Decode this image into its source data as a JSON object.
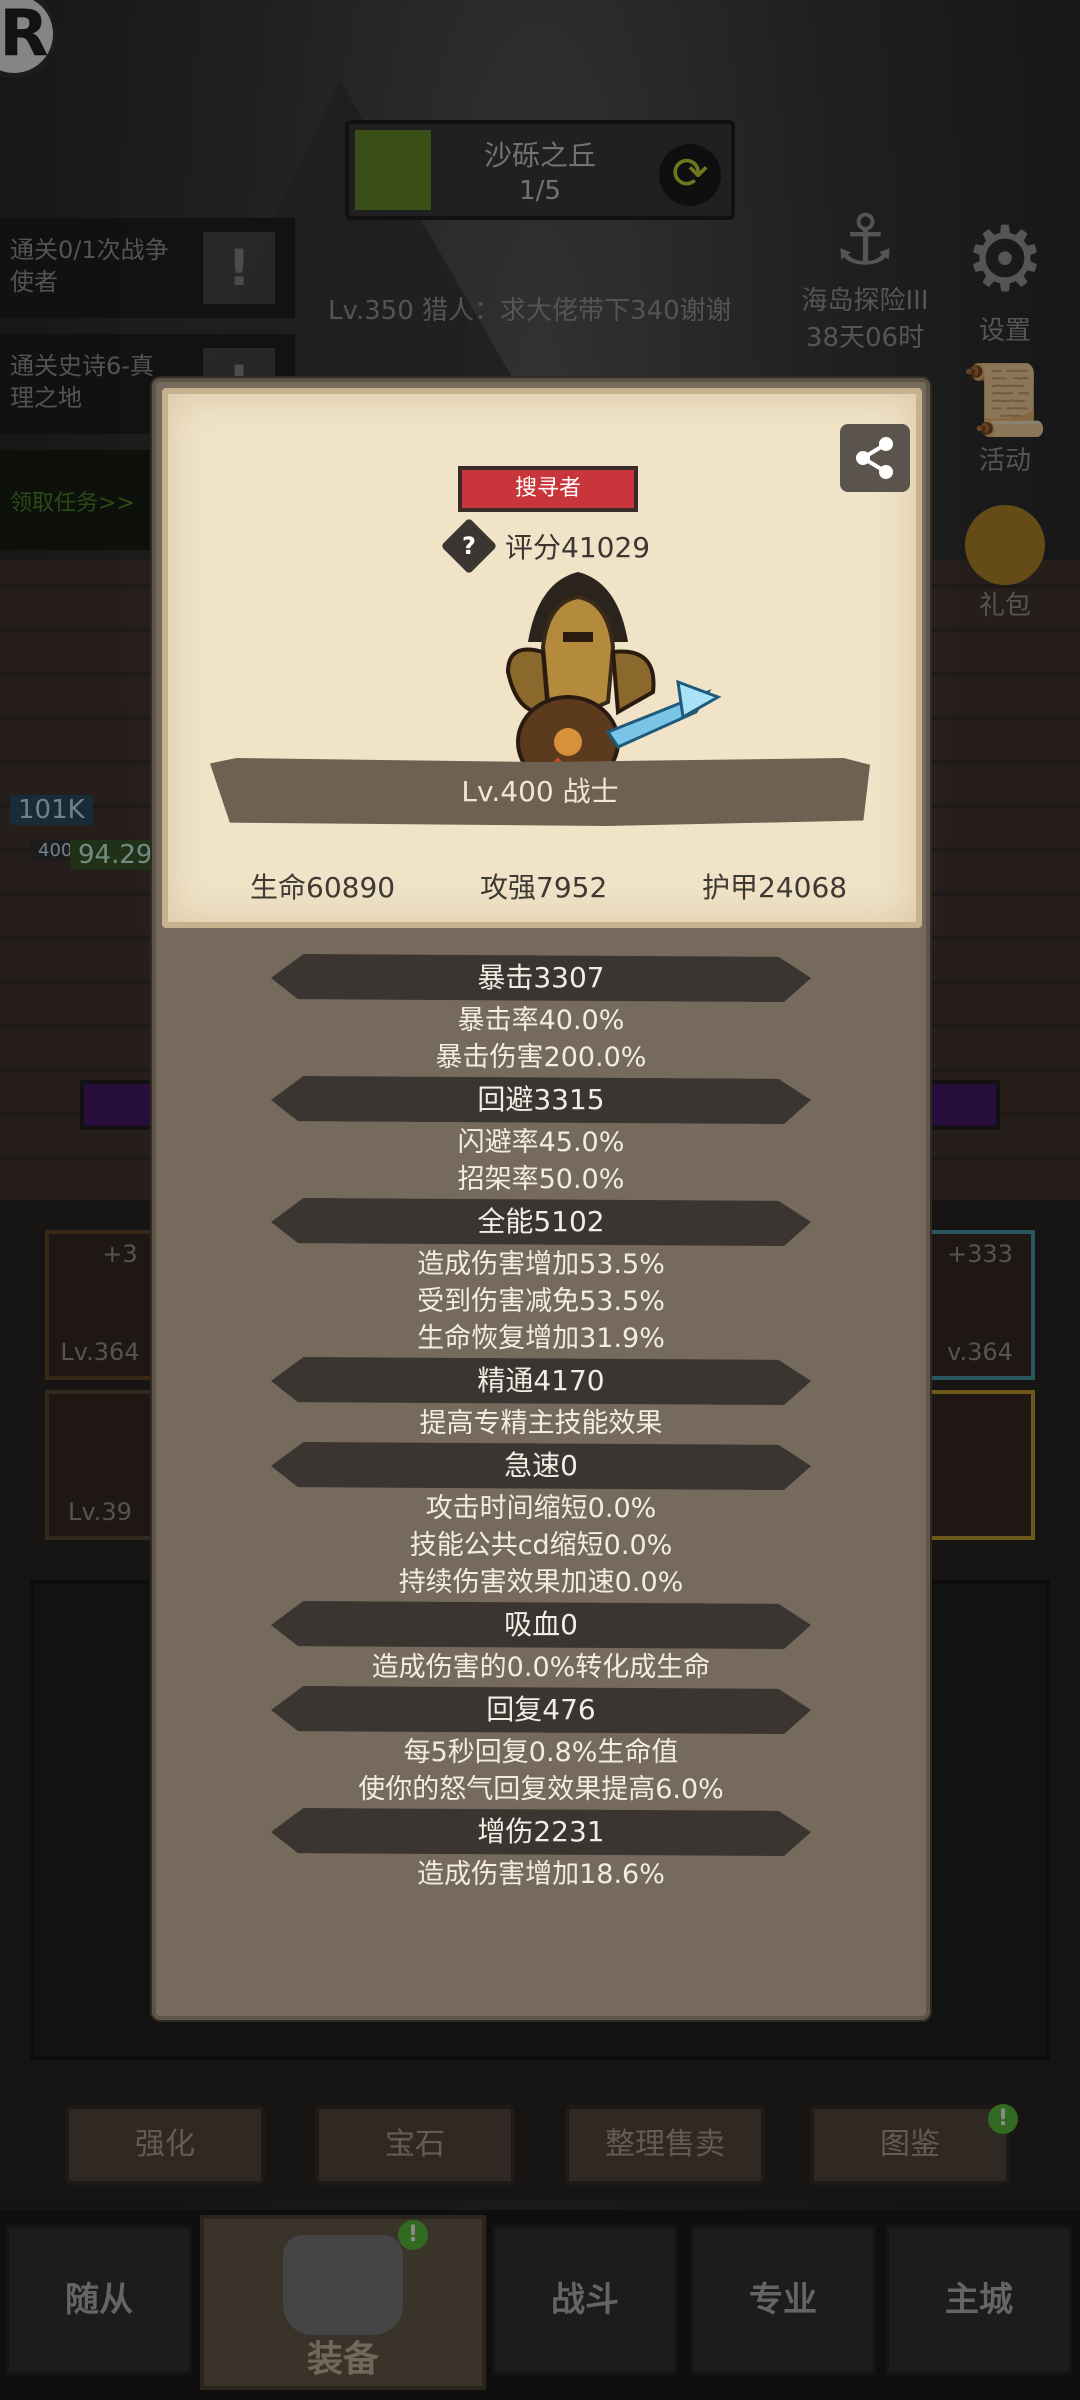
{
  "stage": {
    "name": "沙砾之丘",
    "progress": "1/5",
    "progress_fraction": 0.2
  },
  "hunter_line": "Lv.350 猎人：求大佬带下340谢谢",
  "left_tasks": [
    {
      "label": "通关0/1次战争使者"
    },
    {
      "label": "通关史诗6-真理之地"
    }
  ],
  "claim_task": "领取任务>>",
  "right_menu": {
    "island": {
      "label": "海岛探险III",
      "timer": "38天06时"
    },
    "settings": "设置",
    "activity": "活动",
    "gift": "礼包"
  },
  "hp_tags": {
    "hp1": "101K",
    "level_small": "400",
    "hp2": "94.29"
  },
  "side_cards": {
    "left_top": {
      "plus": "+3",
      "level": "Lv.364"
    },
    "left_bottom": {
      "level": "Lv.39"
    },
    "right_top": {
      "plus": "+333",
      "level": "v.364"
    }
  },
  "sub_buttons": [
    "强化",
    "宝石",
    "整理售卖",
    "图鉴"
  ],
  "nav": {
    "items": [
      "随从",
      "战斗",
      "专业",
      "主城"
    ],
    "active": "装备"
  },
  "popup": {
    "class_badge": "搜寻者",
    "help_glyph": "?",
    "score": "评分41029",
    "level_class": "Lv.400 战士",
    "main_stats": {
      "hp": "生命60890",
      "atk": "攻强7952",
      "armor": "护甲24068"
    },
    "groups": [
      {
        "head": "暴击3307",
        "lines": [
          "暴击率40.0%",
          "暴击伤害200.0%"
        ]
      },
      {
        "head": "回避3315",
        "lines": [
          "闪避率45.0%",
          "招架率50.0%"
        ]
      },
      {
        "head": "全能5102",
        "lines": [
          "造成伤害增加53.5%",
          "受到伤害减免53.5%",
          "生命恢复增加31.9%"
        ]
      },
      {
        "head": "精通4170",
        "lines": [
          "提高专精主技能效果"
        ]
      },
      {
        "head": "急速0",
        "lines": [
          "攻击时间缩短0.0%",
          "技能公共cd缩短0.0%",
          "持续伤害效果加速0.0%"
        ]
      },
      {
        "head": "吸血0",
        "lines": [
          "造成伤害的0.0%转化成生命"
        ]
      },
      {
        "head": "回复476",
        "lines": [
          "每5秒回复0.8%生命值",
          "使你的怒气回复效果提高6.0%"
        ]
      },
      {
        "head": "增伤2231",
        "lines": [
          "造成伤害增加18.6%"
        ]
      }
    ]
  },
  "colors": {
    "badge_red": "#c8353a",
    "card_bg": "#f0e3c7",
    "panel": "#756a5c",
    "pill": "#3a3530",
    "notify_green": "#5cc23c"
  }
}
